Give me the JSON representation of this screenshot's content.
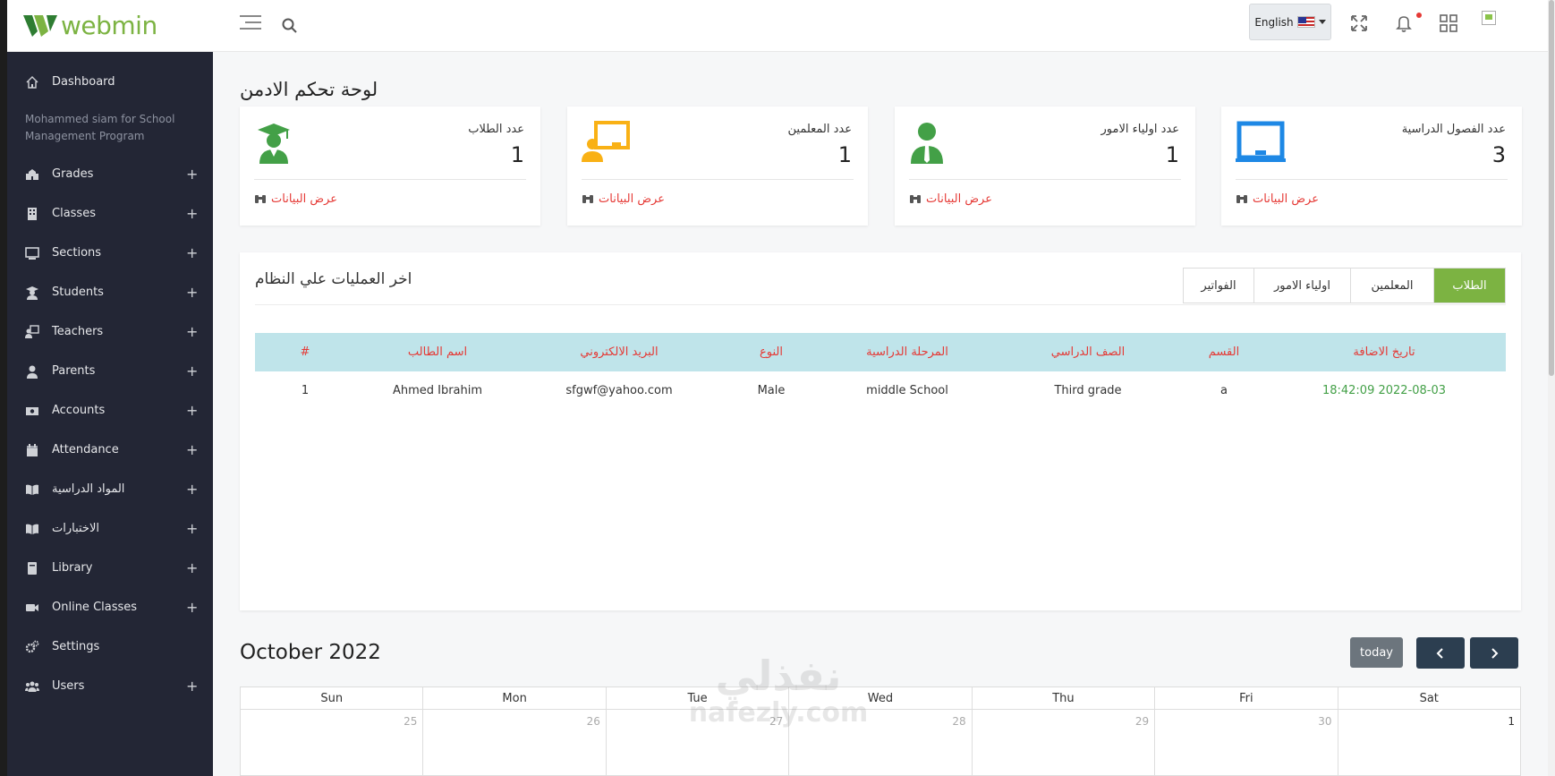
{
  "header": {
    "logo_text": "webmin",
    "language_label": "English"
  },
  "sidebar": {
    "caption": "Mohammed siam for School Management Program",
    "items": [
      {
        "label": "Dashboard",
        "icon": "home-icon",
        "expandable": false
      },
      {
        "label": "Grades",
        "icon": "school-icon",
        "expandable": true
      },
      {
        "label": "Classes",
        "icon": "building-icon",
        "expandable": true
      },
      {
        "label": "Sections",
        "icon": "monitor-icon",
        "expandable": true
      },
      {
        "label": "Students",
        "icon": "graduate-icon",
        "expandable": true
      },
      {
        "label": "Teachers",
        "icon": "teacher-icon",
        "expandable": true
      },
      {
        "label": "Parents",
        "icon": "user-icon",
        "expandable": true
      },
      {
        "label": "Accounts",
        "icon": "money-icon",
        "expandable": true
      },
      {
        "label": "Attendance",
        "icon": "calendar-icon",
        "expandable": true
      },
      {
        "label": "المواد الدراسية",
        "icon": "book-open-icon",
        "expandable": true
      },
      {
        "label": "الاختبارات",
        "icon": "book-open-icon",
        "expandable": true
      },
      {
        "label": "Library",
        "icon": "book-icon",
        "expandable": true
      },
      {
        "label": "Online Classes",
        "icon": "video-icon",
        "expandable": true
      },
      {
        "label": "Settings",
        "icon": "cogs-icon",
        "expandable": false
      },
      {
        "label": "Users",
        "icon": "users-icon",
        "expandable": true
      }
    ]
  },
  "main": {
    "page_title": "لوحة تحكم الادمن",
    "stats": [
      {
        "label": "عدد الطلاب",
        "value": "1",
        "link": "عرض البيانات",
        "icon": "graduate-icon",
        "color": "#43a047"
      },
      {
        "label": "عدد المعلمين",
        "value": "1",
        "link": "عرض البيانات",
        "icon": "teacher-board-icon",
        "color": "#f9b115"
      },
      {
        "label": "عدد اولياء الامور",
        "value": "1",
        "link": "عرض البيانات",
        "icon": "user-tie-icon",
        "color": "#43a047"
      },
      {
        "label": "عدد الفصول الدراسية",
        "value": "3",
        "link": "عرض البيانات",
        "icon": "chalkboard-icon",
        "color": "#1e88e5"
      }
    ],
    "operations": {
      "title": "اخر العمليات علي النظام",
      "tabs": [
        "الطلاب",
        "المعلمين",
        "اولياء الامور",
        "الفواتير"
      ],
      "active_tab": 0,
      "columns": [
        "#",
        "اسم الطالب",
        "البريد الالكتروني",
        "النوع",
        "المرحلة الدراسية",
        "الصف الدراسي",
        "القسم",
        "تاريخ الاضافة"
      ],
      "rows": [
        [
          "1",
          "Ahmed Ibrahim",
          "sfgwf@yahoo.com",
          "Male",
          "middle School",
          "Third grade",
          "a",
          "2022-08-03 18:42:09"
        ]
      ]
    },
    "calendar": {
      "title": "October 2022",
      "today_label": "today",
      "weekdays": [
        "Sun",
        "Mon",
        "Tue",
        "Wed",
        "Thu",
        "Fri",
        "Sat"
      ],
      "first_row": [
        "25",
        "26",
        "27",
        "28",
        "29",
        "30",
        "1"
      ]
    }
  },
  "watermark": {
    "arabic": "نفذلي",
    "latin": "nafezly.com"
  },
  "colors": {
    "sidebar_bg": "#232635",
    "accent_green": "#7cb342",
    "link_red": "#e53935",
    "table_header_bg": "#bfe4ea"
  }
}
